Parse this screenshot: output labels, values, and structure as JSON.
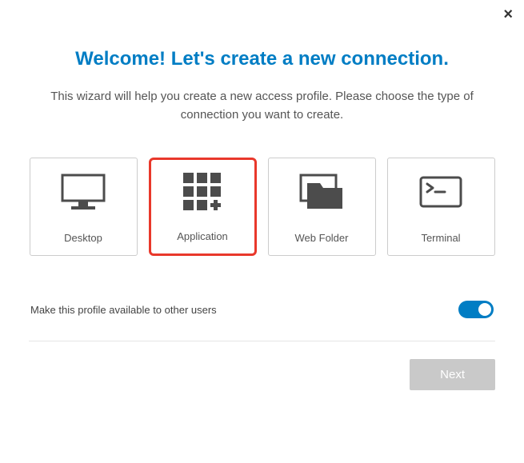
{
  "header": {
    "title": "Welcome! Let's create a new connection.",
    "subtitle": "This wizard will help you create a new access profile. Please choose the type of connection you want to create."
  },
  "options": {
    "desktop": {
      "label": "Desktop"
    },
    "application": {
      "label": "Application"
    },
    "webfolder": {
      "label": "Web Folder"
    },
    "terminal": {
      "label": "Terminal"
    }
  },
  "toggle": {
    "label": "Make this profile available to other users",
    "on": true
  },
  "footer": {
    "next_label": "Next"
  },
  "colors": {
    "accent": "#007dc4",
    "selected": "#e9382b",
    "icon": "#4c4c4c"
  }
}
